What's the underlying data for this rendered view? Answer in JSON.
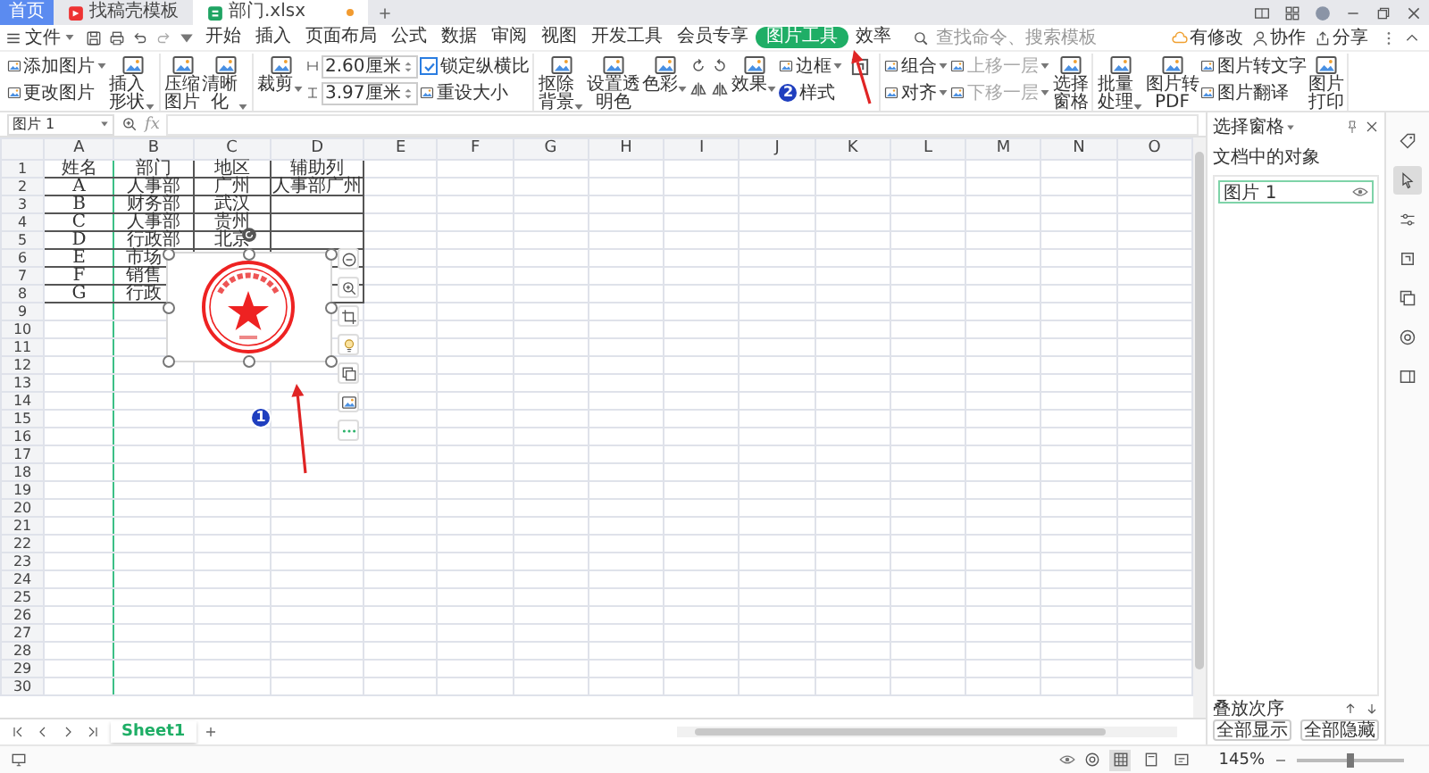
{
  "tabs": [
    {
      "label": "首页",
      "kind": "home",
      "selected": false,
      "modified": false
    },
    {
      "label": "找稿壳模板",
      "kind": "template",
      "selected": false,
      "modified": false
    },
    {
      "label": "部门.xlsx",
      "kind": "sheet",
      "selected": true,
      "modified": true
    }
  ],
  "menu": {
    "file": "文件",
    "items": [
      {
        "label": "开始",
        "selected": false
      },
      {
        "label": "插入",
        "selected": false
      },
      {
        "label": "页面布局",
        "selected": false
      },
      {
        "label": "公式",
        "selected": false
      },
      {
        "label": "数据",
        "selected": false
      },
      {
        "label": "审阅",
        "selected": false
      },
      {
        "label": "视图",
        "selected": false
      },
      {
        "label": "开发工具",
        "selected": false
      },
      {
        "label": "会员专享",
        "selected": false
      },
      {
        "label": "图片工具",
        "selected": true
      },
      {
        "label": "效率",
        "selected": false
      }
    ],
    "search": {
      "placeholder": "查找命令、搜索模板"
    },
    "actions": [
      "有修改",
      "协作",
      "分享"
    ]
  },
  "ribbon": [
    {
      "items": [
        {
          "kind": "stack",
          "items": [
            {
              "kind": "small",
              "label": "添加图片",
              "dropdown": true
            },
            {
              "kind": "small",
              "label": "更改图片"
            }
          ]
        },
        {
          "kind": "big",
          "label": "插入形状",
          "dropdown": true
        }
      ]
    },
    {
      "items": [
        {
          "kind": "big",
          "label": "压缩图片"
        },
        {
          "kind": "big",
          "label": "清晰化",
          "dropdown": true
        }
      ]
    },
    {
      "items": [
        {
          "kind": "big",
          "label": "裁剪",
          "dropdown": true
        },
        {
          "kind": "stack",
          "items": [
            {
              "kind": "spin",
              "value": "2.60厘米"
            },
            {
              "kind": "spin",
              "value": "3.97厘米"
            }
          ]
        },
        {
          "kind": "stack",
          "items": [
            {
              "kind": "check",
              "label": "锁定纵横比",
              "checked": true
            },
            {
              "kind": "small",
              "label": "重设大小"
            }
          ]
        }
      ]
    },
    {
      "items": [
        {
          "kind": "big",
          "label": "抠除背景",
          "dropdown": true
        },
        {
          "kind": "big",
          "label": "设置透明色"
        },
        {
          "kind": "big",
          "label": "色彩",
          "dropdown": true
        },
        {
          "kind": "tools"
        },
        {
          "kind": "big",
          "label": "效果",
          "dropdown": true
        },
        {
          "kind": "stack",
          "items": [
            {
              "kind": "small",
              "label": "边框",
              "dropdown": true
            },
            {
              "kind": "small",
              "label": "样式",
              "badge": "2"
            }
          ]
        },
        {
          "kind": "icon_big"
        }
      ]
    },
    {
      "items": [
        {
          "kind": "stack",
          "items": [
            {
              "kind": "small",
              "label": "组合",
              "dropdown": true,
              "disabled": false
            },
            {
              "kind": "small",
              "label": "对齐",
              "dropdown": true,
              "disabled": false
            }
          ]
        },
        {
          "kind": "stack",
          "items": [
            {
              "kind": "small",
              "label": "上移一层",
              "dropdown": true,
              "disabled": true
            },
            {
              "kind": "small",
              "label": "下移一层",
              "dropdown": true,
              "disabled": true
            }
          ]
        },
        {
          "kind": "big",
          "label": "选择窗格"
        }
      ]
    },
    {
      "items": [
        {
          "kind": "big",
          "label": "批量处理",
          "dropdown": true
        },
        {
          "kind": "big",
          "label": "图片转PDF"
        },
        {
          "kind": "stack",
          "items": [
            {
              "kind": "small",
              "label": "图片转文字"
            },
            {
              "kind": "small",
              "label": "图片翻译"
            }
          ]
        },
        {
          "kind": "big",
          "label": "图片打印"
        }
      ]
    }
  ],
  "formula_bar": {
    "name_box": "图片 1",
    "fx": "fx"
  },
  "grid": {
    "columns": [
      "A",
      "B",
      "C",
      "D",
      "E",
      "F",
      "G",
      "H",
      "I",
      "J",
      "K",
      "L",
      "M",
      "N",
      "O"
    ],
    "row_numbers": [
      "1",
      "2",
      "3",
      "4",
      "5",
      "6",
      "7",
      "8",
      "9",
      "10",
      "11",
      "12",
      "13",
      "14",
      "15",
      "16",
      "17",
      "18",
      "19",
      "20",
      "21",
      "22",
      "23",
      "24",
      "25",
      "26",
      "27",
      "28",
      "29",
      "30"
    ],
    "rows": [
      [
        "姓名",
        "部门",
        "地区",
        "辅助列"
      ],
      [
        "A",
        "人事部",
        "广州",
        "人事部广州"
      ],
      [
        "B",
        "财务部",
        "武汉"
      ],
      [
        "C",
        "人事部",
        "贵州"
      ],
      [
        "D",
        "行政部",
        "北京"
      ],
      [
        "E",
        "市场"
      ],
      [
        "F",
        "销售"
      ],
      [
        "G",
        "行政"
      ]
    ]
  },
  "annotations": {
    "grid_badge": "1"
  },
  "selection_pane": {
    "title": "选择窗格",
    "subtitle": "文档中的对象",
    "objects": [
      {
        "label": "图片 1",
        "selected": true
      }
    ],
    "order_label": "叠放次序",
    "buttons": [
      "全部显示",
      "全部隐藏"
    ]
  },
  "side_tools": [
    {
      "selected": false
    },
    {
      "selected": true
    },
    {
      "selected": false
    },
    {
      "selected": false
    },
    {
      "selected": false
    },
    {
      "selected": false
    },
    {
      "selected": false
    }
  ],
  "sheets": [
    {
      "label": "Sheet1",
      "selected": true
    }
  ],
  "status_bar": {
    "zoom": "145%",
    "zoom_level": {
      "level": 0.5
    },
    "views": [
      {
        "selected": true
      },
      {
        "selected": false
      },
      {
        "selected": false
      }
    ]
  }
}
